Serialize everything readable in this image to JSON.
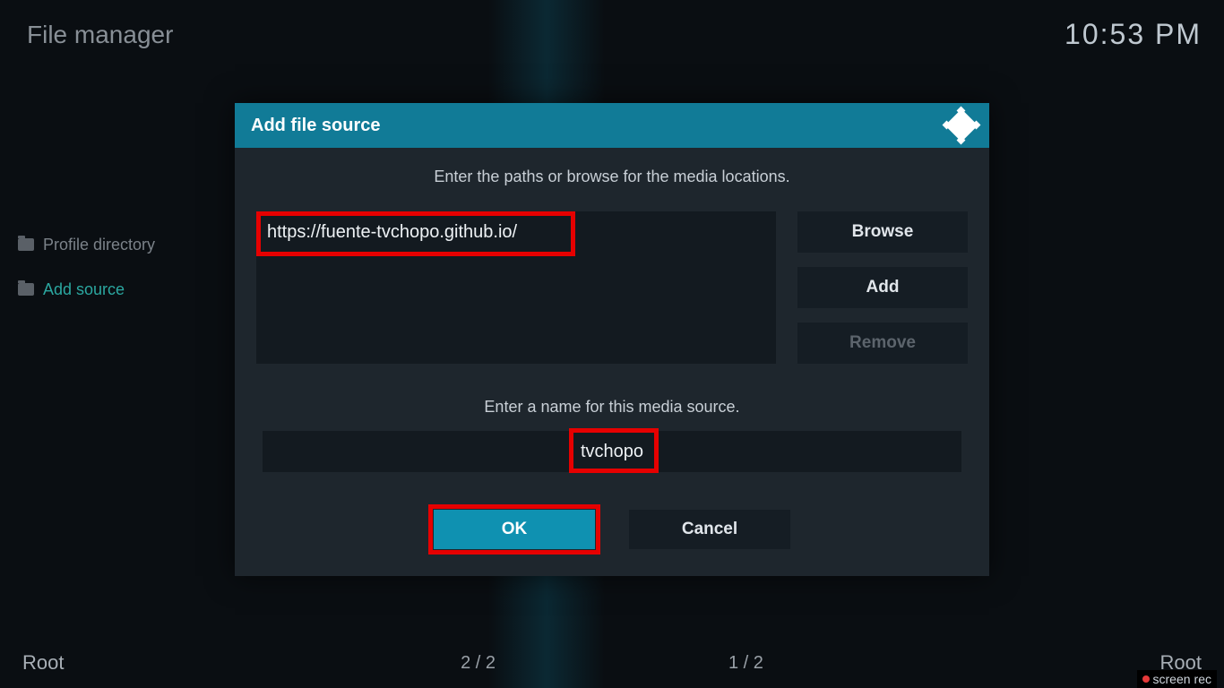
{
  "header": {
    "title": "File manager",
    "clock": "10:53 PM"
  },
  "sidebar": {
    "items": [
      {
        "label": "Profile directory"
      },
      {
        "label": "Add source"
      }
    ]
  },
  "dialog": {
    "title": "Add file source",
    "instruction_paths": "Enter the paths or browse for the media locations.",
    "path_value": "https://fuente-tvchopo.github.io/",
    "browse_label": "Browse",
    "add_label": "Add",
    "remove_label": "Remove",
    "instruction_name": "Enter a name for this media source.",
    "name_value": "tvchopo",
    "ok_label": "OK",
    "cancel_label": "Cancel"
  },
  "footer": {
    "left_root": "Root",
    "left_counter": "2 / 2",
    "right_counter": "1 / 2",
    "right_root": "Root",
    "screenrec_brand_a": "screen",
    "screenrec_brand_b": "rec"
  }
}
